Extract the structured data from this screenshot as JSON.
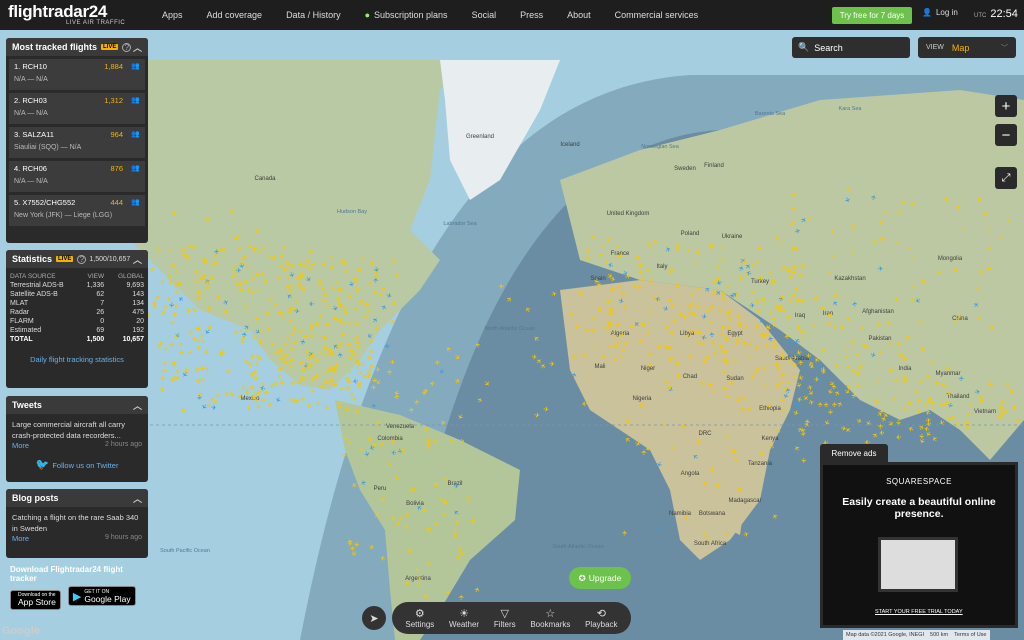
{
  "brand": {
    "name": "flightradar24",
    "tagline": "LIVE AIR TRAFFIC"
  },
  "nav": [
    "Apps",
    "Add coverage",
    "Data / History",
    "Subscription plans",
    "Social",
    "Press",
    "About",
    "Commercial services"
  ],
  "header": {
    "trial": "Try free for 7 days",
    "login": "Log in",
    "utc": "UTC",
    "time": "22:54"
  },
  "tracked": {
    "title": "Most tracked flights",
    "live": "LIVE",
    "flights": [
      {
        "callsign": "1. RCH10",
        "route": "N/A — N/A",
        "count": "1,884"
      },
      {
        "callsign": "2. RCH03",
        "route": "N/A — N/A",
        "count": "1,312"
      },
      {
        "callsign": "3. SALZA11",
        "route": "Siauliai (SQQ) — N/A",
        "count": "964"
      },
      {
        "callsign": "4. RCH06",
        "route": "N/A — N/A",
        "count": "876"
      },
      {
        "callsign": "5. X7552/CHG552",
        "route": "New York (JFK) — Liege (LGG)",
        "count": "444"
      }
    ]
  },
  "stats": {
    "title": "Statistics",
    "live": "LIVE",
    "summary": "1,500/10,657",
    "headers": [
      "DATA SOURCE",
      "VIEW",
      "GLOBAL"
    ],
    "rows": [
      [
        "Terrestrial ADS-B",
        "1,336",
        "9,693"
      ],
      [
        "Satellite ADS-B",
        "62",
        "143"
      ],
      [
        "MLAT",
        "7",
        "134"
      ],
      [
        "Radar",
        "26",
        "475"
      ],
      [
        "FLARM",
        "0",
        "20"
      ],
      [
        "Estimated",
        "69",
        "192"
      ]
    ],
    "total": [
      "TOTAL",
      "1,500",
      "10,657"
    ],
    "link": "Daily flight tracking statistics"
  },
  "tweets": {
    "title": "Tweets",
    "text": "Large commercial aircraft all carry crash-protected data recorders...",
    "more": "More",
    "time": "2 hours ago",
    "follow": "Follow us on Twitter"
  },
  "blog": {
    "title": "Blog posts",
    "text": "Catching a flight on the rare Saab 340 in Sweden",
    "more": "More",
    "time": "9 hours ago"
  },
  "download": {
    "title": "Download Flightradar24 flight tracker",
    "appstore_small": "Download on the",
    "appstore": "App Store",
    "gplay_small": "GET IT ON",
    "gplay": "Google Play"
  },
  "search": {
    "label": "Search"
  },
  "view": {
    "label": "VIEW",
    "value": "Map"
  },
  "map": {
    "labels": {
      "greenland": "Greenland",
      "iceland": "Iceland",
      "canada": "Canada",
      "mexico": "Mexico",
      "venezuela": "Venezuela",
      "colombia": "Colombia",
      "brazil": "Brazil",
      "peru": "Peru",
      "bolivia": "Bolivia",
      "argentina": "Argentina",
      "uk": "United Kingdom",
      "sweden": "Sweden",
      "finland": "Finland",
      "poland": "Poland",
      "ukraine": "Ukraine",
      "france": "France",
      "spain": "Spain",
      "italy": "Italy",
      "algeria": "Algeria",
      "libya": "Libya",
      "egypt": "Egypt",
      "mali": "Mali",
      "niger": "Niger",
      "chad": "Chad",
      "sudan": "Sudan",
      "ethiopia": "Ethiopia",
      "nigeria": "Nigeria",
      "drc": "DRC",
      "kenya": "Kenya",
      "tanzania": "Tanzania",
      "angola": "Angola",
      "namibia": "Namibia",
      "botswana": "Botswana",
      "south_africa": "South Africa",
      "madagascar": "Madagascar",
      "kazakhstan": "Kazakhstan",
      "mongolia": "Mongolia",
      "china": "China",
      "iran": "Iran",
      "saudi": "Saudi Arabia",
      "turkey": "Turkey",
      "iraq": "Iraq",
      "afghanistan": "Afghanistan",
      "pakistan": "Pakistan",
      "india": "India",
      "myanmar": "Myanmar",
      "thailand": "Thailand",
      "vietnam": "Vietnam",
      "north_atlantic": "North Atlantic Ocean",
      "south_atlantic": "South Atlantic Ocean",
      "south_pacific": "South Pacific Ocean",
      "labrador": "Labrador Sea",
      "hudson": "Hudson Bay",
      "barents": "Barents Sea",
      "kara": "Kara Sea",
      "norwegian": "Norwegian Sea"
    }
  },
  "upgrade": "Upgrade",
  "tools": [
    "Settings",
    "Weather",
    "Filters",
    "Bookmarks",
    "Playback"
  ],
  "ad": {
    "tab": "Remove ads",
    "brand": "SQUARESPACE",
    "headline": "Easily create a beautiful online presence.",
    "cta": "START YOUR FREE TRIAL TODAY"
  },
  "footer": {
    "google": "Google",
    "mapdata": "Map data ©2021 Google, INEGI",
    "scale": "500 km",
    "terms": "Terms of Use"
  }
}
